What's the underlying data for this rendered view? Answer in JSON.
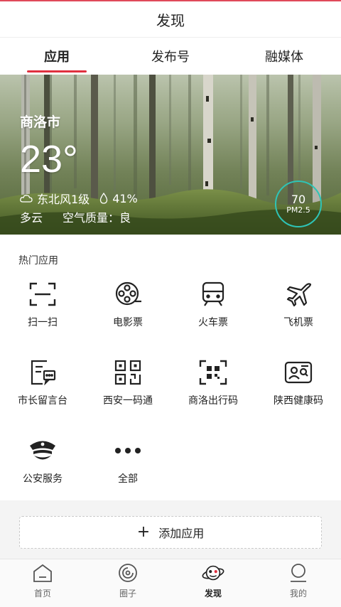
{
  "header": {
    "title": "发现"
  },
  "tabs": [
    {
      "label": "应用",
      "active": true
    },
    {
      "label": "发布号",
      "active": false
    },
    {
      "label": "融媒体",
      "active": false
    }
  ],
  "weather": {
    "city": "商洛市",
    "temperature": "23°",
    "wind": "东北风1级",
    "humidity": "41%",
    "condition": "多云",
    "air_quality": "空气质量：良",
    "pm_value": "70",
    "pm_label": "PM2.5",
    "pm_ring_color": "#2ec4b6"
  },
  "hot_apps": {
    "title": "热门应用",
    "items": [
      {
        "label": "扫一扫",
        "icon": "scan-icon"
      },
      {
        "label": "电影票",
        "icon": "film-reel-icon"
      },
      {
        "label": "火车票",
        "icon": "train-icon"
      },
      {
        "label": "飞机票",
        "icon": "airplane-icon"
      },
      {
        "label": "市长留言台",
        "icon": "message-board-icon"
      },
      {
        "label": "西安一码通",
        "icon": "qr-code-icon"
      },
      {
        "label": "商洛出行码",
        "icon": "travel-code-icon"
      },
      {
        "label": "陕西健康码",
        "icon": "health-code-icon"
      },
      {
        "label": "公安服务",
        "icon": "police-cap-icon"
      },
      {
        "label": "全部",
        "icon": "more-dots-icon"
      }
    ]
  },
  "add_app": {
    "label": "添加应用"
  },
  "bottom_nav": [
    {
      "label": "首页",
      "icon": "home-icon",
      "active": false
    },
    {
      "label": "圈子",
      "icon": "circle-icon",
      "active": false
    },
    {
      "label": "发现",
      "icon": "planet-icon",
      "active": true
    },
    {
      "label": "我的",
      "icon": "user-icon",
      "active": false
    }
  ],
  "colors": {
    "accent": "#e0303f",
    "pm_ring": "#2ec4b6"
  }
}
